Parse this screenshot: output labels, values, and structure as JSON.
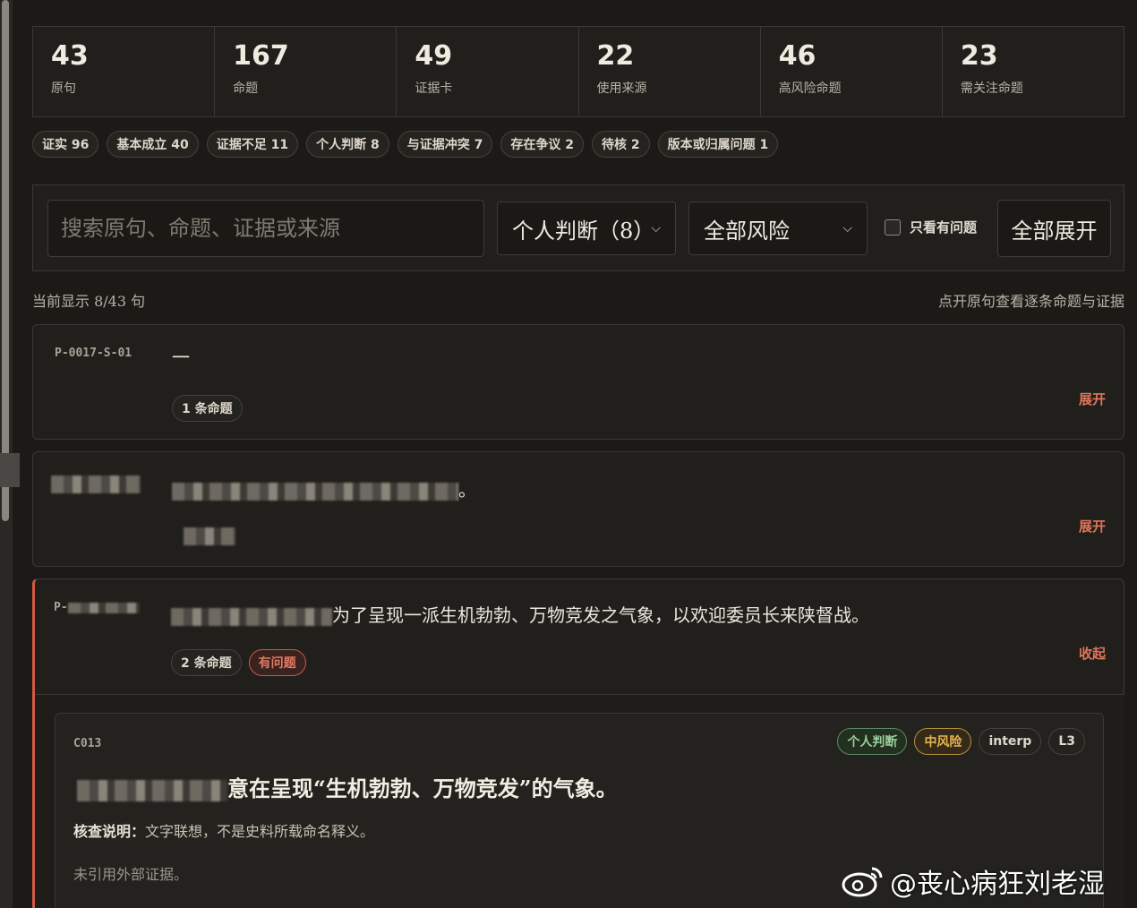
{
  "stats": [
    {
      "value": "43",
      "label": "原句"
    },
    {
      "value": "167",
      "label": "命题"
    },
    {
      "value": "49",
      "label": "证据卡"
    },
    {
      "value": "22",
      "label": "使用来源"
    },
    {
      "value": "46",
      "label": "高风险命题"
    },
    {
      "value": "23",
      "label": "需关注命题"
    }
  ],
  "chips": [
    "证实 96",
    "基本成立 40",
    "证据不足 11",
    "个人判断 8",
    "与证据冲突 7",
    "存在争议 2",
    "待核 2",
    "版本或归属问题 1"
  ],
  "filters": {
    "search_placeholder": "搜索原句、命题、证据或来源",
    "verdict_select": "个人判断（8）",
    "risk_select": "全部风险",
    "only_issues_label": "只看有问题",
    "expand_all": "全部展开"
  },
  "summary": {
    "count_text": "当前显示 8/43 句",
    "hint": "点开原句查看逐条命题与证据"
  },
  "cards": [
    {
      "id": "P-0017-S-01",
      "text": "一",
      "claims_pill": "1 条命题",
      "toggle": "展开"
    },
    {
      "id": "",
      "text": "。",
      "claims_pill": "",
      "toggle": "展开"
    },
    {
      "id": "P-",
      "text": "为了呈现一派生机勃勃、万物竞发之气象，以欢迎委员长来陕督战。",
      "claims_pill": "2 条命题",
      "issue_pill": "有问题",
      "toggle": "收起"
    }
  ],
  "claim": {
    "id": "C013",
    "tags": [
      "个人判断",
      "中风险",
      "interp",
      "L3"
    ],
    "text": "意在呈现“生机勃勃、万物竞发”的气象。",
    "note_label": "核查说明：",
    "note": "文字联想，不是史料所载命名释义。",
    "evidence": "未引用外部证据。"
  },
  "watermark": "@丧心病狂刘老湿"
}
